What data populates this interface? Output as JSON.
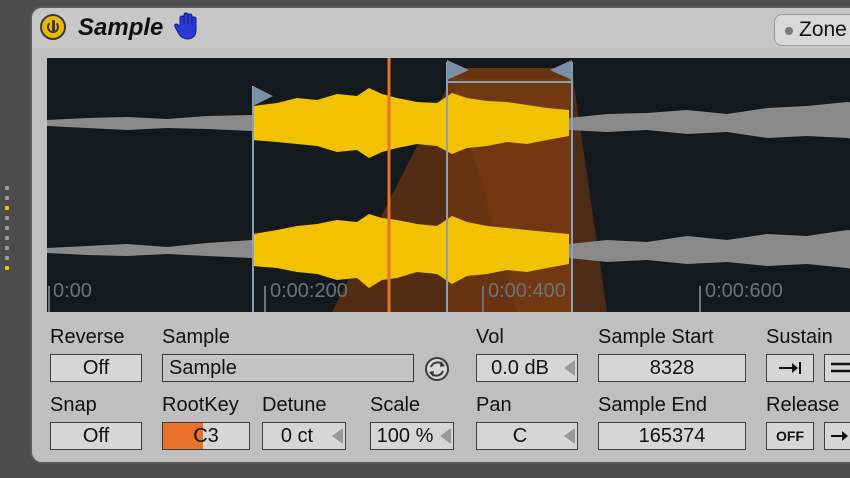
{
  "device": {
    "title": "Sample",
    "zone_label": "Zone"
  },
  "waveform": {
    "time_labels": [
      "0:00",
      "0:00:200",
      "0:00:400",
      "0:00:600"
    ]
  },
  "params": {
    "reverse": {
      "label": "Reverse",
      "value": "Off"
    },
    "snap": {
      "label": "Snap",
      "value": "Off"
    },
    "sample": {
      "label": "Sample",
      "value": "Sample"
    },
    "rootkey": {
      "label": "RootKey",
      "value": "C3"
    },
    "detune": {
      "label": "Detune",
      "value": "0 ct"
    },
    "scale": {
      "label": "Scale",
      "value": "100 %"
    },
    "vol": {
      "label": "Vol",
      "value": "0.0 dB"
    },
    "pan": {
      "label": "Pan",
      "value": "C"
    },
    "sample_start": {
      "label": "Sample Start",
      "value": "8328"
    },
    "sample_end": {
      "label": "Sample End",
      "value": "165374"
    },
    "sustain": {
      "label": "Sustain"
    },
    "release": {
      "label": "Release",
      "off_value": "OFF"
    }
  },
  "colors": {
    "accent": "#f2c200",
    "orange": "#e8722a",
    "waveform_bg": "#14191e"
  }
}
